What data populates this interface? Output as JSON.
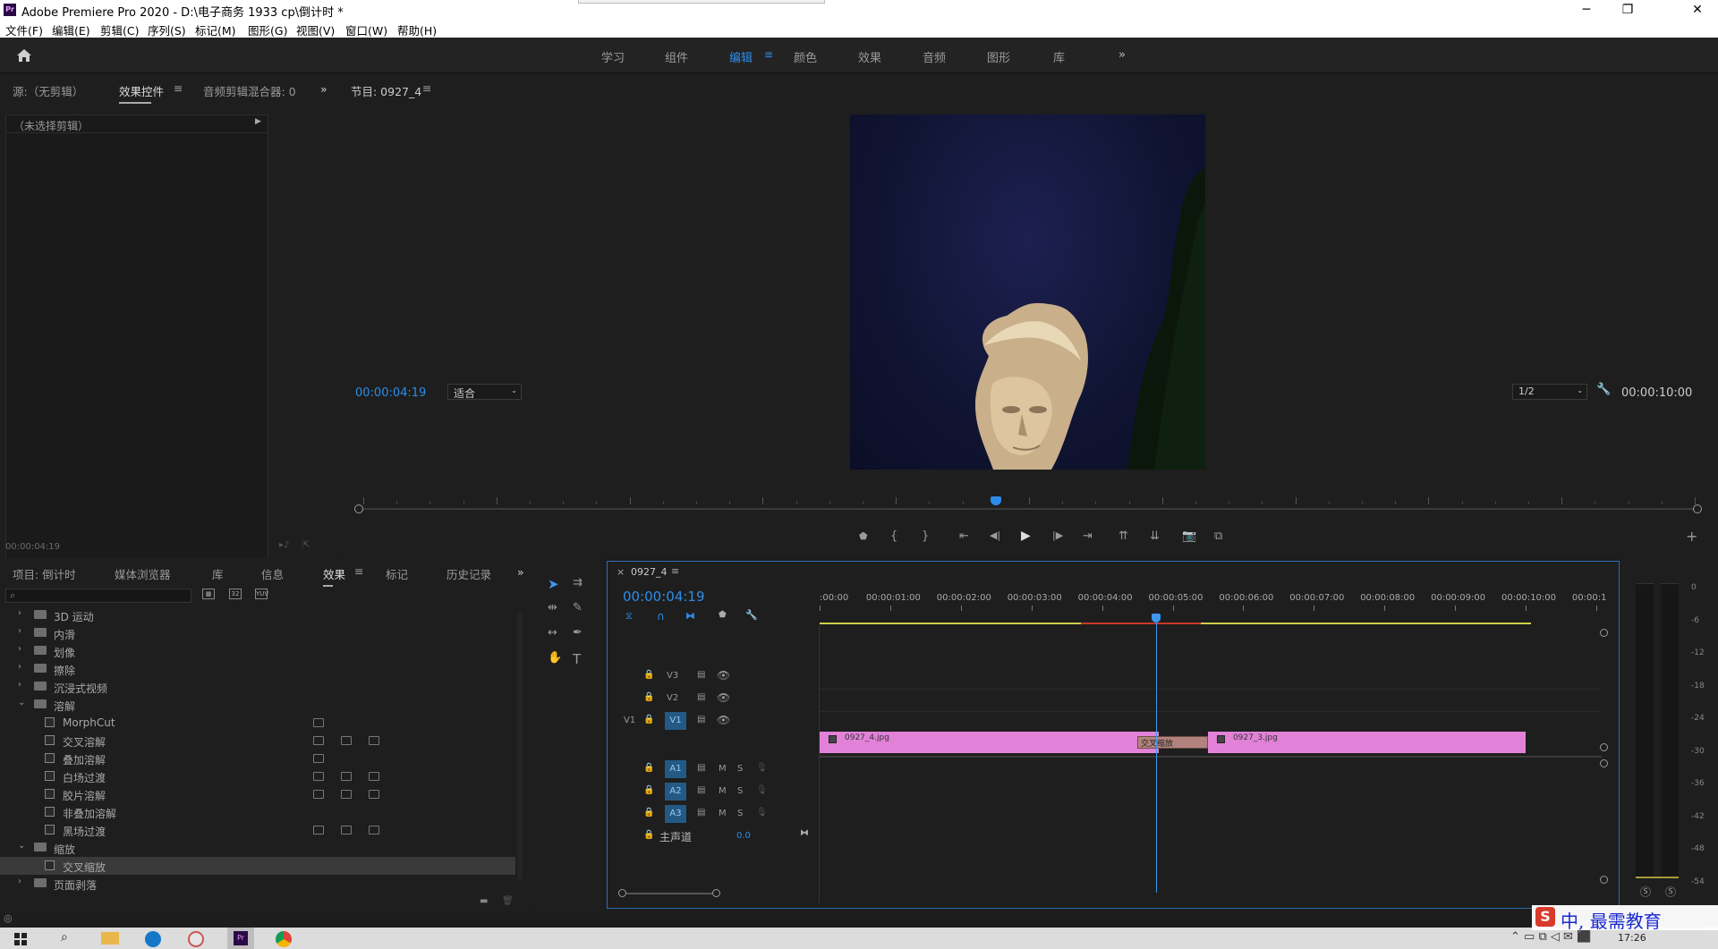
{
  "title_bar": {
    "title": "Adobe Premiere Pro 2020 - D:\\电子商务 1933 cp\\倒计时 *",
    "icon": "premiere-logo",
    "minimize": "─",
    "maximize": "❐",
    "close": "✕"
  },
  "menu": [
    "文件(F)",
    "编辑(E)",
    "剪辑(C)",
    "序列(S)",
    "标记(M)",
    "图形(G)",
    "视图(V)",
    "窗口(W)",
    "帮助(H)"
  ],
  "workspaces": {
    "tabs": [
      "学习",
      "组件",
      "编辑",
      "颜色",
      "效果",
      "音频",
      "图形",
      "库"
    ],
    "active": "编辑",
    "more": "»"
  },
  "source_panel": {
    "tabs": [
      "源:（无剪辑）",
      "效果控件",
      "音频剪辑混合器: 0"
    ],
    "active_tab": "效果控件",
    "no_clip": "（未选择剪辑）",
    "timecode": "00:00:04:19"
  },
  "program_monitor": {
    "title": "节目: 0927_4",
    "timecode": "00:00:04:19",
    "fit": "适合",
    "resolution": "1/2",
    "duration": "00:00:10:00",
    "playhead_fraction": 0.475
  },
  "project_panel": {
    "tabs": [
      "项目: 倒计时",
      "媒体浏览器",
      "库",
      "信息",
      "效果",
      "标记",
      "历史记录"
    ],
    "active_tab": "效果",
    "items": [
      {
        "type": "folder",
        "label": "3D 运动",
        "expanded": false,
        "level": 0
      },
      {
        "type": "folder",
        "label": "内滑",
        "expanded": false,
        "level": 0
      },
      {
        "type": "folder",
        "label": "划像",
        "expanded": false,
        "level": 0
      },
      {
        "type": "folder",
        "label": "擦除",
        "expanded": false,
        "level": 0
      },
      {
        "type": "folder",
        "label": "沉浸式视频",
        "expanded": false,
        "level": 0
      },
      {
        "type": "folder",
        "label": "溶解",
        "expanded": true,
        "level": 0
      },
      {
        "type": "effect",
        "label": "MorphCut",
        "level": 1,
        "badges": 1
      },
      {
        "type": "effect",
        "label": "交叉溶解",
        "level": 1,
        "badges": 3
      },
      {
        "type": "effect",
        "label": "叠加溶解",
        "level": 1,
        "badges": 1
      },
      {
        "type": "effect",
        "label": "白场过渡",
        "level": 1,
        "badges": 3
      },
      {
        "type": "effect",
        "label": "胶片溶解",
        "level": 1,
        "badges": 3
      },
      {
        "type": "effect",
        "label": "非叠加溶解",
        "level": 1,
        "badges": 0
      },
      {
        "type": "effect",
        "label": "黑场过渡",
        "level": 1,
        "badges": 3
      },
      {
        "type": "folder",
        "label": "缩放",
        "expanded": true,
        "level": 0
      },
      {
        "type": "effect",
        "label": "交叉缩放",
        "level": 1,
        "badges": 0,
        "selected": true
      },
      {
        "type": "folder",
        "label": "页面剥落",
        "expanded": false,
        "level": 0
      }
    ]
  },
  "timeline": {
    "sequence": "0927_4",
    "timecode": "00:00:04:19",
    "ruler": [
      ":00:00",
      "00:00:01:00",
      "00:00:02:00",
      "00:00:03:00",
      "00:00:04:00",
      "00:00:05:00",
      "00:00:06:00",
      "00:00:07:00",
      "00:00:08:00",
      "00:00:09:00",
      "00:00:10:00",
      "00:00:1"
    ],
    "video_tracks": [
      "V3",
      "V2",
      "V1"
    ],
    "audio_tracks": [
      "A1",
      "A2",
      "A3"
    ],
    "mute": "M",
    "solo": "S",
    "master_label": "主声道",
    "master_value": "0.0",
    "source_label": "V1",
    "clips": [
      {
        "name": "0927_4.jpg",
        "start": 0,
        "end": 4.8
      },
      {
        "name": "0927_3.jpg",
        "start": 5.5,
        "end": 10
      }
    ],
    "transition": {
      "name": "交叉缩放",
      "start": 4.5,
      "end": 5.5
    },
    "playhead_seconds": 4.76
  },
  "audio_meter": {
    "scale": [
      "0",
      "-6",
      "-12",
      "-18",
      "-24",
      "-30",
      "-36",
      "-42",
      "-48",
      "-54"
    ],
    "solo_buttons": [
      "S",
      "S"
    ]
  },
  "taskbar": {
    "time": "17:26",
    "watermark": "中, 最需教育",
    "ime": "中"
  },
  "colors": {
    "accent": "#2d8ceb",
    "clip": "#e281d8",
    "transition": "#b2837e",
    "track_target": "#235a85",
    "timeline_border": "#2d6db0"
  }
}
